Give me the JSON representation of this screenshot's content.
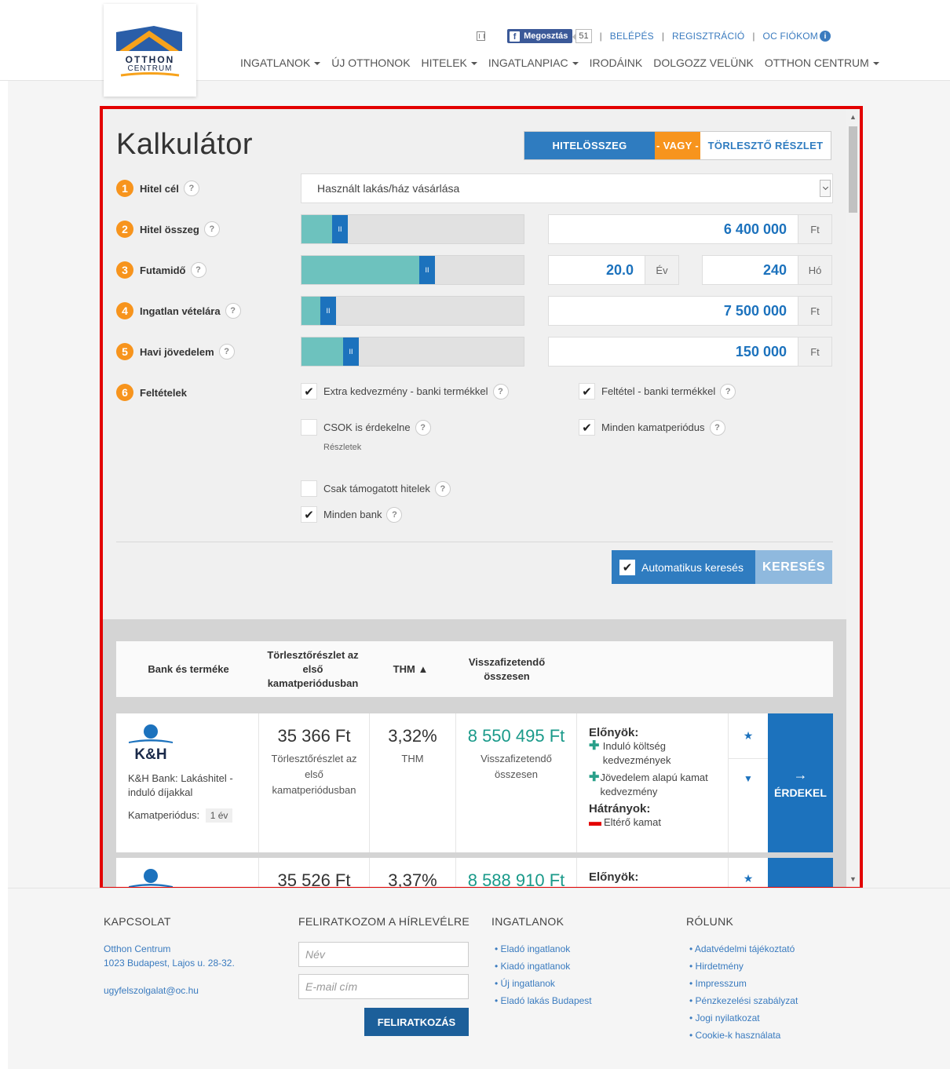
{
  "header": {
    "logo_text_top": "OTTHON",
    "logo_text_bottom": "CENTRUM",
    "facebook_share": "Megosztás",
    "facebook_count": "51",
    "login": "BELÉPÉS",
    "register": "REGISZTRÁCIÓ",
    "account": "OC FIÓKOM",
    "nav": [
      "INGATLANOK",
      "ÚJ OTTHONOK",
      "HITELEK",
      "INGATLANPIAC",
      "IRODÁINK",
      "DOLGOZZ VELÜNK",
      "OTTHON CENTRUM"
    ]
  },
  "calculator": {
    "title": "Kalkulátor",
    "mode": {
      "loan_amount": "HITELÖSSZEG",
      "or": "- VAGY -",
      "installment": "TÖRLESZTŐ RÉSZLET"
    },
    "rows": [
      {
        "num": "1",
        "label": "Hitel cél"
      },
      {
        "num": "2",
        "label": "Hitel összeg"
      },
      {
        "num": "3",
        "label": "Futamidő"
      },
      {
        "num": "4",
        "label": "Ingatlan vételára"
      },
      {
        "num": "5",
        "label": "Havi jövedelem"
      },
      {
        "num": "6",
        "label": "Feltételek"
      }
    ],
    "loan_purpose": "Használt lakás/ház vásárlása",
    "loan_amount": {
      "value": "6 400 000",
      "unit": "Ft",
      "slider_fraction": 0.15
    },
    "term": {
      "years": "20.0",
      "years_unit": "Év",
      "months": "240",
      "months_unit": "Hó",
      "slider_fraction": 0.57
    },
    "property_price": {
      "value": "7 500 000",
      "unit": "Ft",
      "slider_fraction": 0.09
    },
    "monthly_income": {
      "value": "150 000",
      "unit": "Ft",
      "slider_fraction": 0.2
    },
    "conditions": {
      "extra_discount": "Extra kedvezmény - banki termékkel",
      "condition_bank": "Feltétel - banki termékkel",
      "csok": "CSOK is érdekelne",
      "details": "Részletek",
      "all_periods": "Minden kamatperiódus",
      "only_supported": "Csak támogatott hitelek",
      "all_banks": "Minden bank"
    },
    "auto_search": "Automatikus keresés",
    "search": "KERESÉS",
    "question_mark": "?"
  },
  "results": {
    "headers": {
      "bank": "Bank és terméke",
      "installment": "Törlesztőrészlet az első kamatperiódusban",
      "thm": "THM ▲",
      "total": "Visszafizetendő összesen"
    },
    "items": [
      {
        "bank_logo": "K&H",
        "product": "K&H Bank: Lakáshitel - induló díjakkal",
        "period_label": "Kamatperiódus:",
        "period_value": "1 év",
        "installment": "35 366 Ft",
        "installment_label": "Törlesztőrészlet az első kamatperiódusban",
        "thm": "3,32%",
        "thm_label": "THM",
        "total": "8 550 495 Ft",
        "total_label": "Visszafizetendő összesen",
        "pros_title": "Előnyök:",
        "pros": [
          "Induló költség kedvezmények",
          "Jövedelem alapú kamat kedvezmény"
        ],
        "cons_title": "Hátrányok:",
        "cons": [
          "Eltérő kamat"
        ],
        "action": "ÉRDEKEL"
      },
      {
        "installment": "35 526 Ft",
        "thm": "3,37%",
        "total": "8 588 910 Ft",
        "pros_title": "Előnyök:"
      }
    ]
  },
  "footer": {
    "contact": {
      "title": "KAPCSOLAT",
      "name": "Otthon Centrum",
      "address": "1023 Budapest, Lajos u. 28-32.",
      "email": "ugyfelszolgalat@oc.hu"
    },
    "newsletter": {
      "title": "FELIRATKOZOM A HÍRLEVÉLRE",
      "name_placeholder": "Név",
      "email_placeholder": "E-mail cím",
      "button": "FELIRATKOZÁS"
    },
    "properties": {
      "title": "INGATLANOK",
      "links": [
        "Eladó ingatlanok",
        "Kiadó ingatlanok",
        "Új ingatlanok",
        "Eladó lakás Budapest"
      ]
    },
    "about": {
      "title": "RÓLUNK",
      "links": [
        "Adatvédelmi tájékoztató",
        "Hirdetmény",
        "Impresszum",
        "Pénzkezelési szabályzat",
        "Jogi nyilatkozat",
        "Cookie-k használata"
      ]
    }
  }
}
